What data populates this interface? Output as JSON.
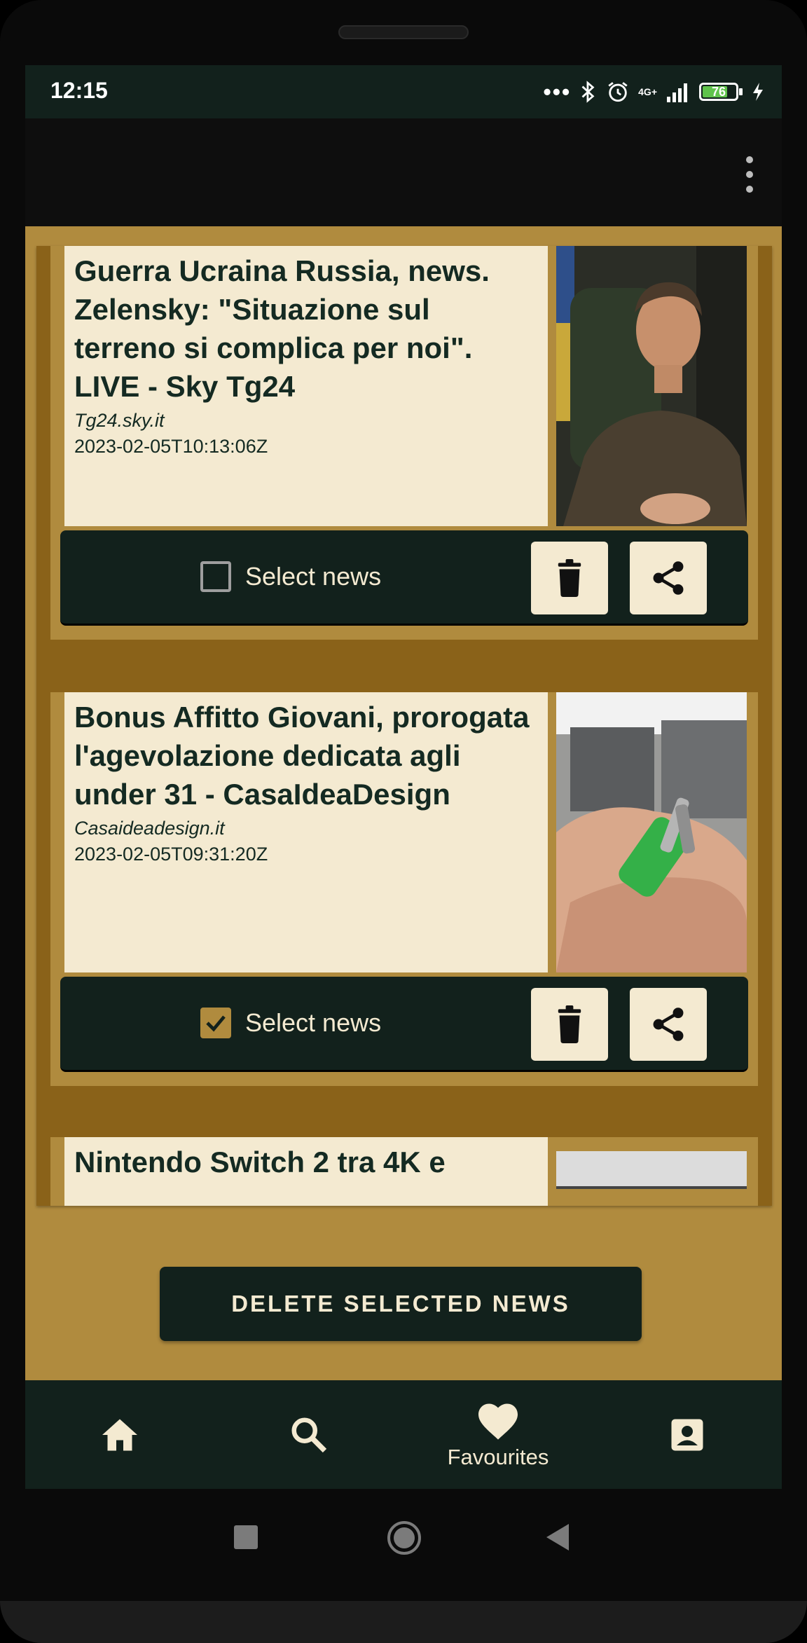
{
  "status_bar": {
    "time": "12:15",
    "network": "4G+",
    "battery": "76",
    "battery_level": 0.76
  },
  "news": [
    {
      "title": "Guerra Ucraina Russia, news. Zelensky: \"Situazione sul terreno si complica per noi\". LIVE - Sky Tg24",
      "source": "Tg24.sky.it",
      "date": "2023-02-05T10:13:06Z",
      "select_label": "Select news",
      "selected": false
    },
    {
      "title": "Bonus Affitto Giovani, prorogata l'agevolazione dedicata agli under 31 - CasaIdeaDesign",
      "source": "Casaideadesign.it",
      "date": "2023-02-05T09:31:20Z",
      "select_label": "Select news",
      "selected": true
    },
    {
      "title": "Nintendo Switch 2 tra 4K e"
    }
  ],
  "delete_button": "DELETE SELECTED NEWS",
  "bottom_nav": {
    "items": [
      {
        "icon": "home-icon",
        "label": ""
      },
      {
        "icon": "search-icon",
        "label": ""
      },
      {
        "icon": "heart-icon",
        "label": "Favourites"
      },
      {
        "icon": "account-box-icon",
        "label": ""
      }
    ]
  },
  "colors": {
    "accent": "#b08b3e",
    "dark": "#12211c",
    "card": "#f4ead1"
  }
}
